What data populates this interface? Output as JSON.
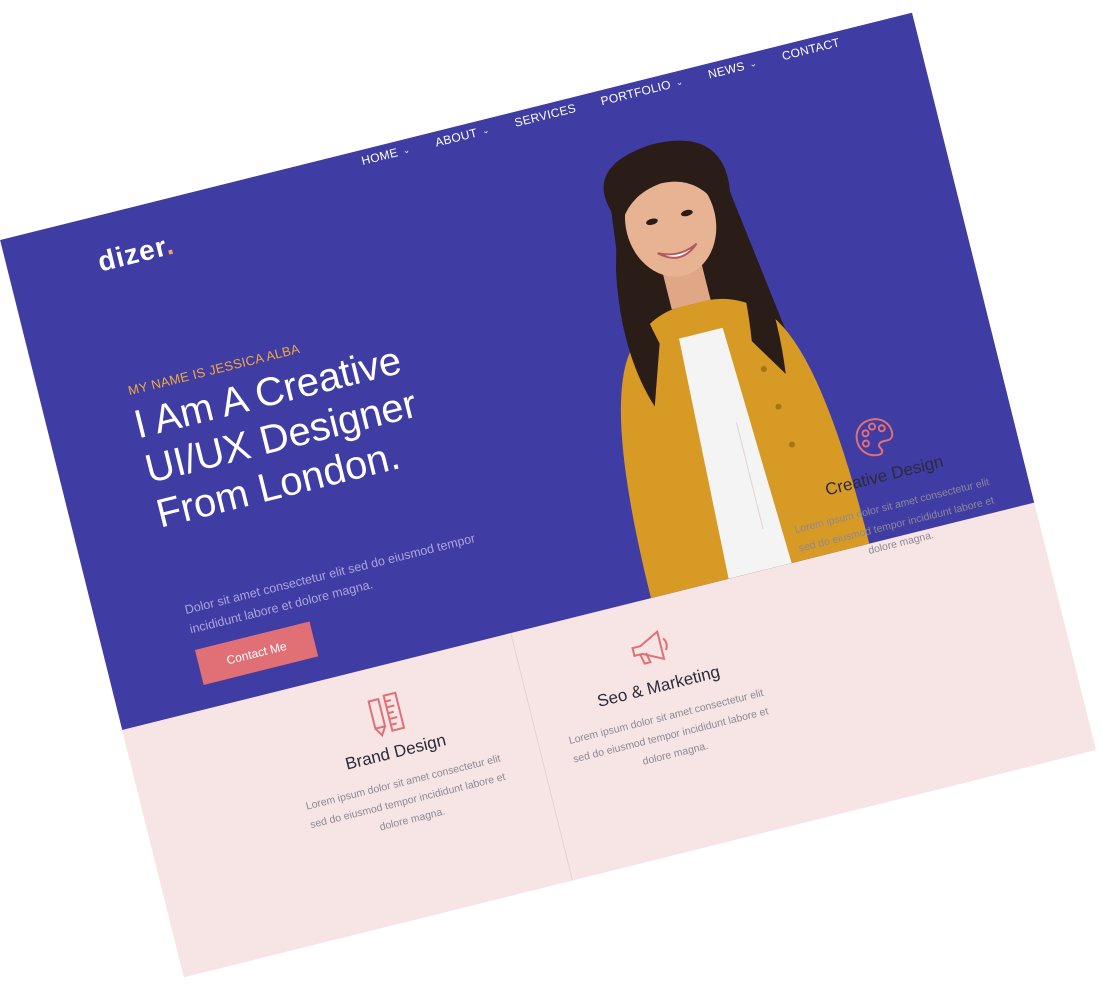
{
  "brand": {
    "name": "dizer",
    "dot": "."
  },
  "nav": {
    "items": [
      {
        "label": "HOME",
        "has_dropdown": true
      },
      {
        "label": "ABOUT",
        "has_dropdown": true
      },
      {
        "label": "SERVICES",
        "has_dropdown": false
      },
      {
        "label": "PORTFOLIO",
        "has_dropdown": true
      },
      {
        "label": "NEWS",
        "has_dropdown": true
      },
      {
        "label": "CONTACT",
        "has_dropdown": false
      }
    ]
  },
  "hero": {
    "tagline": "MY NAME IS JESSICA ALBA",
    "headline_lines": [
      "I Am A Creative",
      "UI/UX Designer",
      "From London."
    ],
    "description": "Dolor sit amet consectetur elit sed do eiusmod tempor incididunt labore et dolore magna.",
    "cta_label": "Contact Me"
  },
  "services": [
    {
      "icon": "pencil-ruler-icon",
      "title": "Brand Design",
      "text": "Lorem ipsum dolor sit amet consectetur elit sed do eiusmod tempor incididunt labore et dolore magna."
    },
    {
      "icon": "megaphone-icon",
      "title": "Seo & Marketing",
      "text": "Lorem ipsum dolor sit amet consectetur elit sed do eiusmod tempor incididunt labore et dolore magna."
    },
    {
      "icon": "palette-icon",
      "title": "Creative Design",
      "text": "Lorem ipsum dolor sit amet consectetur elit sed do eiusmod tempor incididunt labore et dolore magna."
    }
  ],
  "colors": {
    "hero_bg": "#3f3ca3",
    "accent": "#e16f76",
    "tagline": "#f0a940",
    "services_bg": "#f7e4e5"
  }
}
